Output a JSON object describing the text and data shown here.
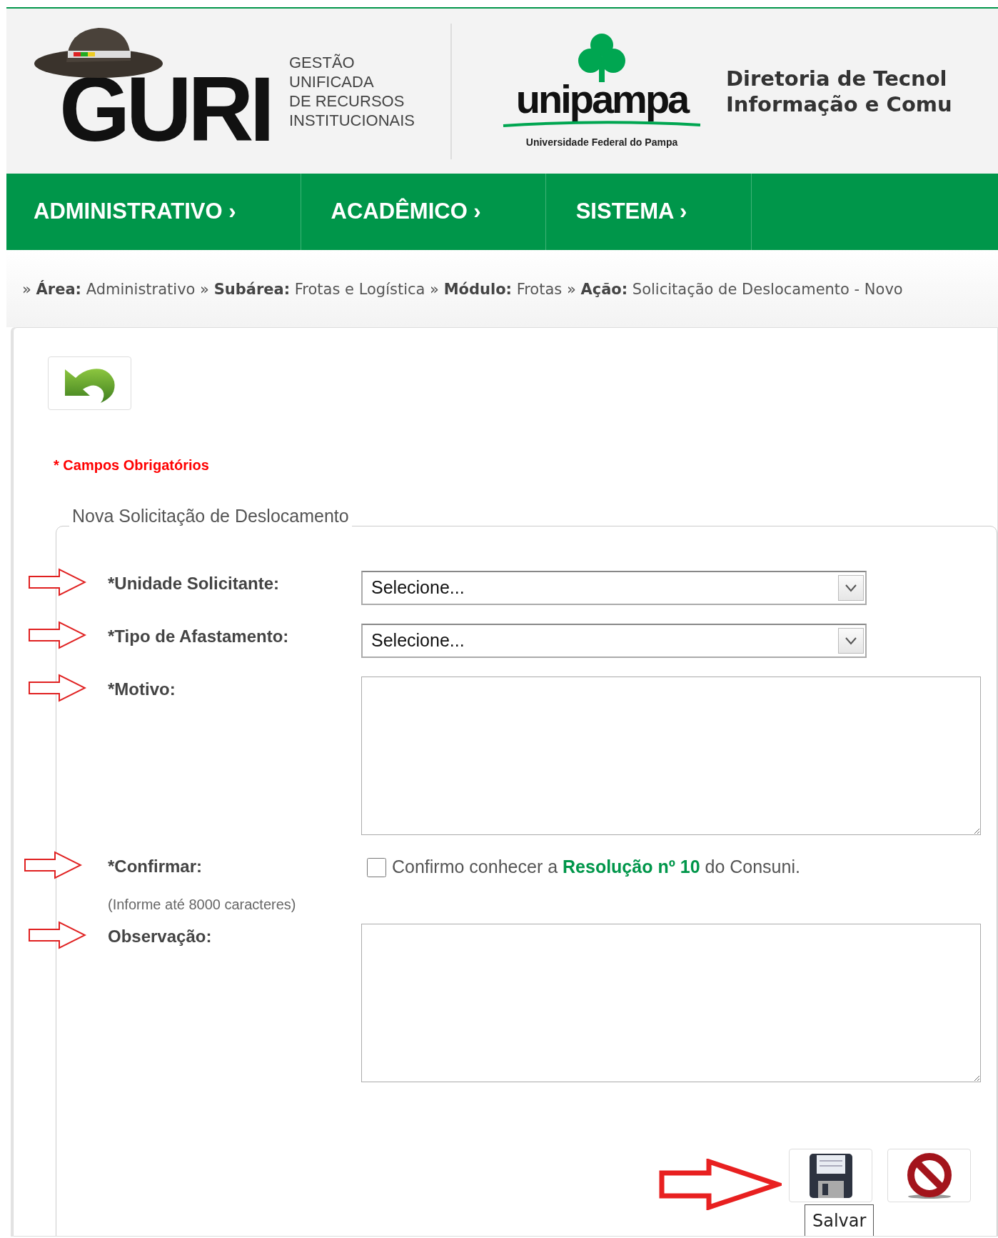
{
  "header": {
    "logo_text": "GURI",
    "logo_subtitle": [
      "GESTÃO",
      "UNIFICADA",
      "DE RECURSOS",
      "INSTITUCIONAIS"
    ],
    "university_logo_text": "unipampa",
    "university_name": "Universidade Federal do Pampa",
    "directorate": [
      "Diretoria de Tecnol",
      "Informação e Comu"
    ]
  },
  "nav": [
    {
      "label": "ADMINISTRATIVO ›"
    },
    {
      "label": "ACADÊMICO ›"
    },
    {
      "label": "SISTEMA ›"
    }
  ],
  "breadcrumb": [
    {
      "separator": "»",
      "label": "Área:",
      "value": "Administrativo"
    },
    {
      "separator": "»",
      "label": "Subárea:",
      "value": "Frotas e Logística"
    },
    {
      "separator": "»",
      "label": "Módulo:",
      "value": "Frotas"
    },
    {
      "separator": "»",
      "label": "Ação:",
      "value": "Solicitação de Deslocamento - Novo"
    }
  ],
  "required_note": "* Campos Obrigatórios",
  "form": {
    "legend": "Nova Solicitação de Deslocamento",
    "fields": [
      {
        "kind": "select",
        "label": "*Unidade Solicitante:",
        "value": "Selecione...",
        "annotated": true
      },
      {
        "kind": "select",
        "label": "*Tipo de Afastamento:",
        "value": "Selecione...",
        "annotated": true
      },
      {
        "kind": "textarea",
        "label": "*Motivo:",
        "annotated": true
      },
      {
        "kind": "checkbox",
        "label": "*Confirmar:",
        "checked": false,
        "text_before": "Confirmo conhecer a",
        "link": "Resolução nº 10",
        "text_after": "do Consuni.",
        "annotated": true
      },
      {
        "kind": "textarea",
        "label": "Observação:",
        "hint": "(Informe até 8000 caracteres)",
        "annotated": true
      }
    ],
    "buttons": [
      {
        "kind": "save",
        "tooltip": "Salvar",
        "annotated": true
      },
      {
        "kind": "cancel",
        "annotated": false
      }
    ]
  }
}
